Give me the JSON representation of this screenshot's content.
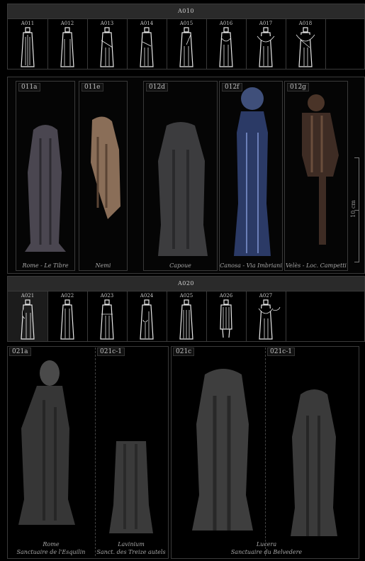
{
  "section1": {
    "title": "A010",
    "thumbs": [
      "A011",
      "A012",
      "A013",
      "A014",
      "A015",
      "A016",
      "A017",
      "A018"
    ]
  },
  "panels1": [
    {
      "label": "011a",
      "caption": "Rome - Le Tibre"
    },
    {
      "label": "011e",
      "caption": "Nemi"
    },
    {
      "label": "012d",
      "caption": "Capoue"
    },
    {
      "label": "012f",
      "caption": "Canosa - Via Imbriani"
    },
    {
      "label": "012g",
      "caption": "Velès - Loc. Campetti"
    }
  ],
  "scale": {
    "label": "10 cm"
  },
  "section2": {
    "title": "A020",
    "thumbs": [
      "A021",
      "A022",
      "A023",
      "A024",
      "A025",
      "A026",
      "A027"
    ]
  },
  "panels2": [
    {
      "label": "021a",
      "caption1": "Rome",
      "caption2": "Sanctuaire de l'Esquilin"
    },
    {
      "label": "021c-1",
      "caption1": "Lavinium",
      "caption2": "Sanct. des Treize autels"
    },
    {
      "label": "021c",
      "caption1": "Lucera",
      "caption2": "Sanctuaire du Belvedere"
    },
    {
      "label": "021c-1"
    }
  ]
}
